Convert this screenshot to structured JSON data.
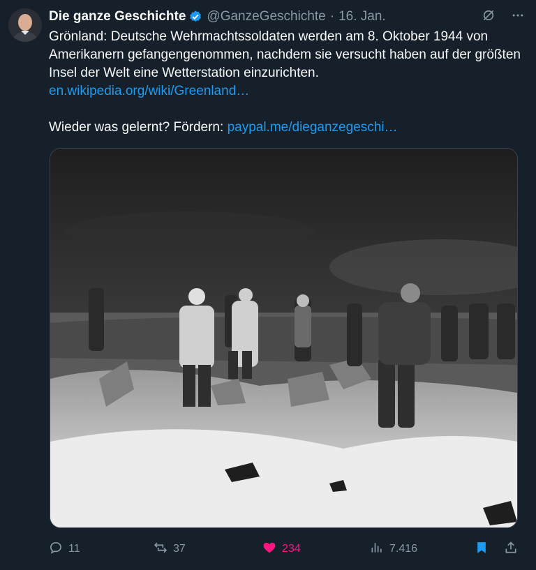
{
  "author": {
    "name": "Die ganze Geschichte",
    "handle": "@GanzeGeschichte",
    "date": "16. Jan."
  },
  "tweet": {
    "text_main": "Grönland: Deutsche Wehrmachtssoldaten werden am 8. Oktober 1944 von Amerikanern gefangengenommen, nachdem sie versucht haben auf der größten Insel der Welt eine Wetterstation einzurichten.",
    "link1": "en.wikipedia.org/wiki/Greenland…",
    "text_support": "Wieder was gelernt? Fördern: ",
    "link2": "paypal.me/dieganzegeschi…"
  },
  "stats": {
    "replies": "11",
    "reposts": "37",
    "likes": "234",
    "views": "7.416"
  },
  "colors": {
    "background": "#15202b",
    "link": "#1d9bf0",
    "like_active": "#f91880",
    "muted": "#8b98a5"
  },
  "icons": [
    "verified-badge-icon",
    "grok-icon",
    "more-icon",
    "reply-icon",
    "repost-icon",
    "like-icon",
    "views-icon",
    "bookmark-icon",
    "share-icon"
  ]
}
